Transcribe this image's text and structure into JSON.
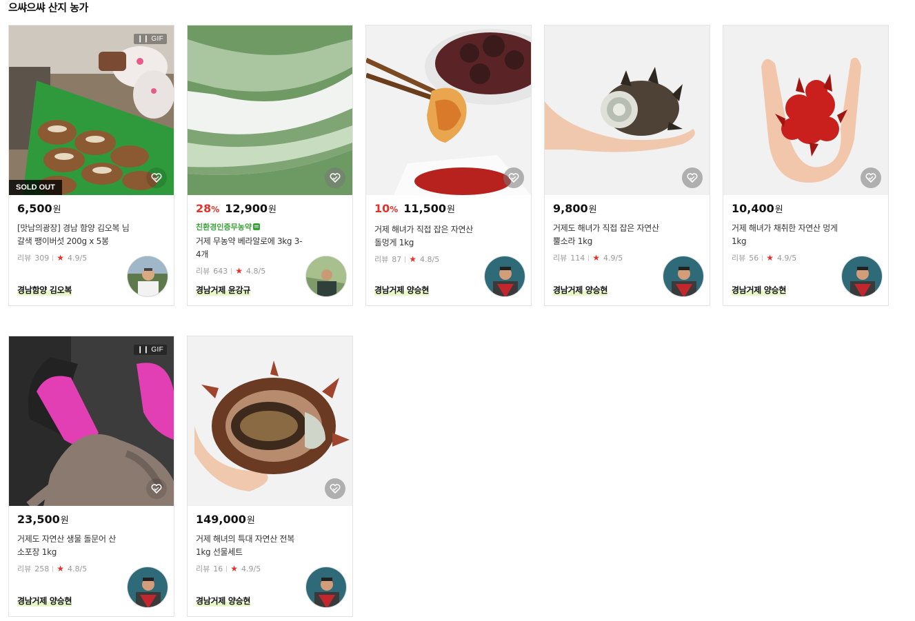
{
  "section": {
    "title": "으쌰으쌰 산지 농가"
  },
  "labels": {
    "won": "원",
    "gif": "GIF",
    "sold_out": "SOLD OUT",
    "review_prefix": "리뷰",
    "star": "★"
  },
  "products": [
    {
      "price": "6,500",
      "discount": "",
      "eco_badge": "",
      "name": "[맛남의광장] 경남 함양 김오복 님 갈색 팽이버섯 200g x 5봉",
      "reviews": "309",
      "rating": "4.9/5",
      "farmer": "경남함양 김오복",
      "gif": true,
      "sold_out": true,
      "image": "mushroom-crate-image"
    },
    {
      "price": "12,900",
      "discount": "28",
      "eco_badge": "친환경인증무농약",
      "name": "거제 무농약 베라알로에 3kg 3-4개",
      "reviews": "643",
      "rating": "4.8/5",
      "farmer": "경남거제 윤강규",
      "gif": false,
      "sold_out": false,
      "image": "aloe-image"
    },
    {
      "price": "11,500",
      "discount": "10",
      "eco_badge": "",
      "name": "거제 해녀가 직접 잡은 자연산 돌멍게 1kg",
      "reviews": "87",
      "rating": "4.8/5",
      "farmer": "경남거제 양승현",
      "gif": false,
      "sold_out": false,
      "image": "sea-squirt-chopsticks-image"
    },
    {
      "price": "9,800",
      "discount": "",
      "eco_badge": "",
      "name": "거제도 해녀가 직접 잡은 자연산 뿔소라 1kg",
      "reviews": "114",
      "rating": "4.9/5",
      "farmer": "경남거제 양승현",
      "gif": false,
      "sold_out": false,
      "image": "turban-shell-image"
    },
    {
      "price": "10,400",
      "discount": "",
      "eco_badge": "",
      "name": "거제 해녀가 채취한 자연산 멍게 1kg",
      "reviews": "56",
      "rating": "4.9/5",
      "farmer": "경남거제 양승현",
      "gif": false,
      "sold_out": false,
      "image": "red-sea-squirt-image"
    },
    {
      "price": "23,500",
      "discount": "",
      "eco_badge": "",
      "name": "거제도 자연산 생물 돌문어 산 소포장 1kg",
      "reviews": "258",
      "rating": "4.8/5",
      "farmer": "경남거제 양승현",
      "gif": true,
      "sold_out": false,
      "image": "octopus-gloves-image"
    },
    {
      "price": "149,000",
      "discount": "",
      "eco_badge": "",
      "name": "거제 해녀의 특대 자연산 전복 1kg 선물세트",
      "reviews": "16",
      "rating": "4.9/5",
      "farmer": "경남거제 양승현",
      "gif": false,
      "sold_out": false,
      "image": "abalone-image"
    }
  ],
  "colors": {
    "discount": "#e4322b",
    "eco": "#3aa33a",
    "farmer_highlight": "#e8f6c8"
  }
}
